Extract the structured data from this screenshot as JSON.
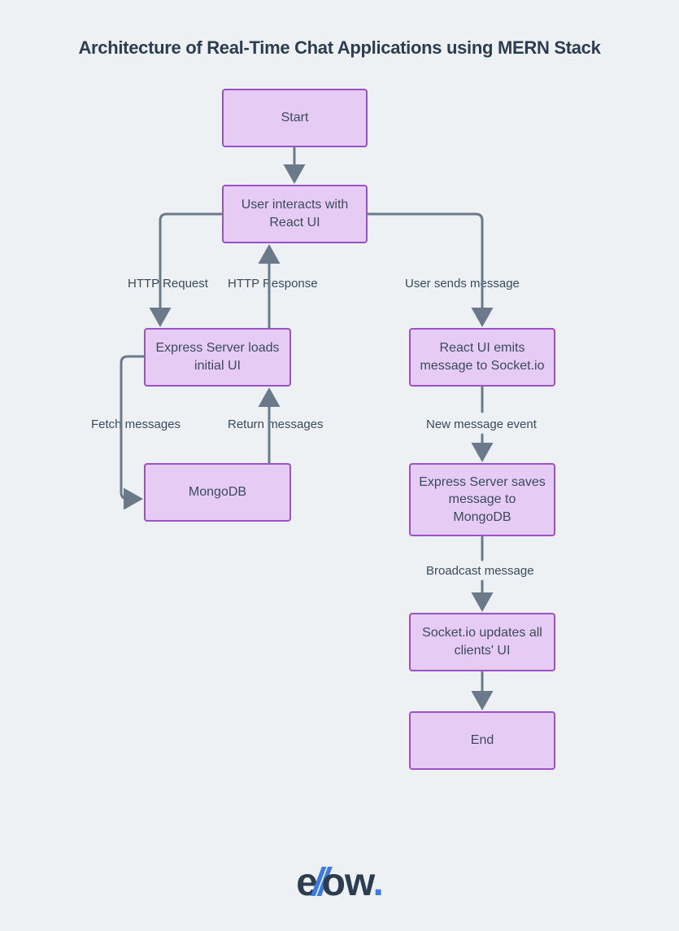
{
  "title": "Architecture of Real-Time Chat Applications using MERN Stack",
  "nodes": {
    "start": "Start",
    "react_ui": "User interacts with React UI",
    "express_load": "Express Server loads initial UI",
    "mongodb": "MongoDB",
    "react_emit": "React UI emits message to Socket.io",
    "express_save": "Express Server saves message to MongoDB",
    "socket_update": "Socket.io updates all clients' UI",
    "end": "End"
  },
  "edges": {
    "http_request": "HTTP Request",
    "http_response": "HTTP Response",
    "user_sends": "User sends message",
    "fetch_messages": "Fetch messages",
    "return_messages": "Return messages",
    "new_message": "New message event",
    "broadcast": "Broadcast message"
  },
  "logo": {
    "part1": "e",
    "slashes": "//",
    "part2": "ow",
    "dot": "."
  },
  "colors": {
    "bg": "#eef1f4",
    "node_fill": "#e6ccf5",
    "node_border": "#9b51c7",
    "text": "#2c3d4f",
    "arrow": "#6b7a8a",
    "accent": "#3b7be0"
  },
  "chart_data": {
    "type": "flowchart",
    "title": "Architecture of Real-Time Chat Applications using MERN Stack",
    "nodes": [
      {
        "id": "start",
        "label": "Start"
      },
      {
        "id": "react_ui",
        "label": "User interacts with React UI"
      },
      {
        "id": "express_load",
        "label": "Express Server loads initial UI"
      },
      {
        "id": "mongodb",
        "label": "MongoDB"
      },
      {
        "id": "react_emit",
        "label": "React UI emits message to Socket.io"
      },
      {
        "id": "express_save",
        "label": "Express Server saves message to MongoDB"
      },
      {
        "id": "socket_update",
        "label": "Socket.io updates all clients' UI"
      },
      {
        "id": "end",
        "label": "End"
      }
    ],
    "edges": [
      {
        "from": "start",
        "to": "react_ui",
        "label": ""
      },
      {
        "from": "react_ui",
        "to": "express_load",
        "label": "HTTP Request"
      },
      {
        "from": "express_load",
        "to": "react_ui",
        "label": "HTTP Response"
      },
      {
        "from": "express_load",
        "to": "mongodb",
        "label": "Fetch messages"
      },
      {
        "from": "mongodb",
        "to": "express_load",
        "label": "Return messages"
      },
      {
        "from": "react_ui",
        "to": "react_emit",
        "label": "User sends message"
      },
      {
        "from": "react_emit",
        "to": "express_save",
        "label": "New message event"
      },
      {
        "from": "express_save",
        "to": "socket_update",
        "label": "Broadcast message"
      },
      {
        "from": "socket_update",
        "to": "end",
        "label": ""
      }
    ]
  }
}
